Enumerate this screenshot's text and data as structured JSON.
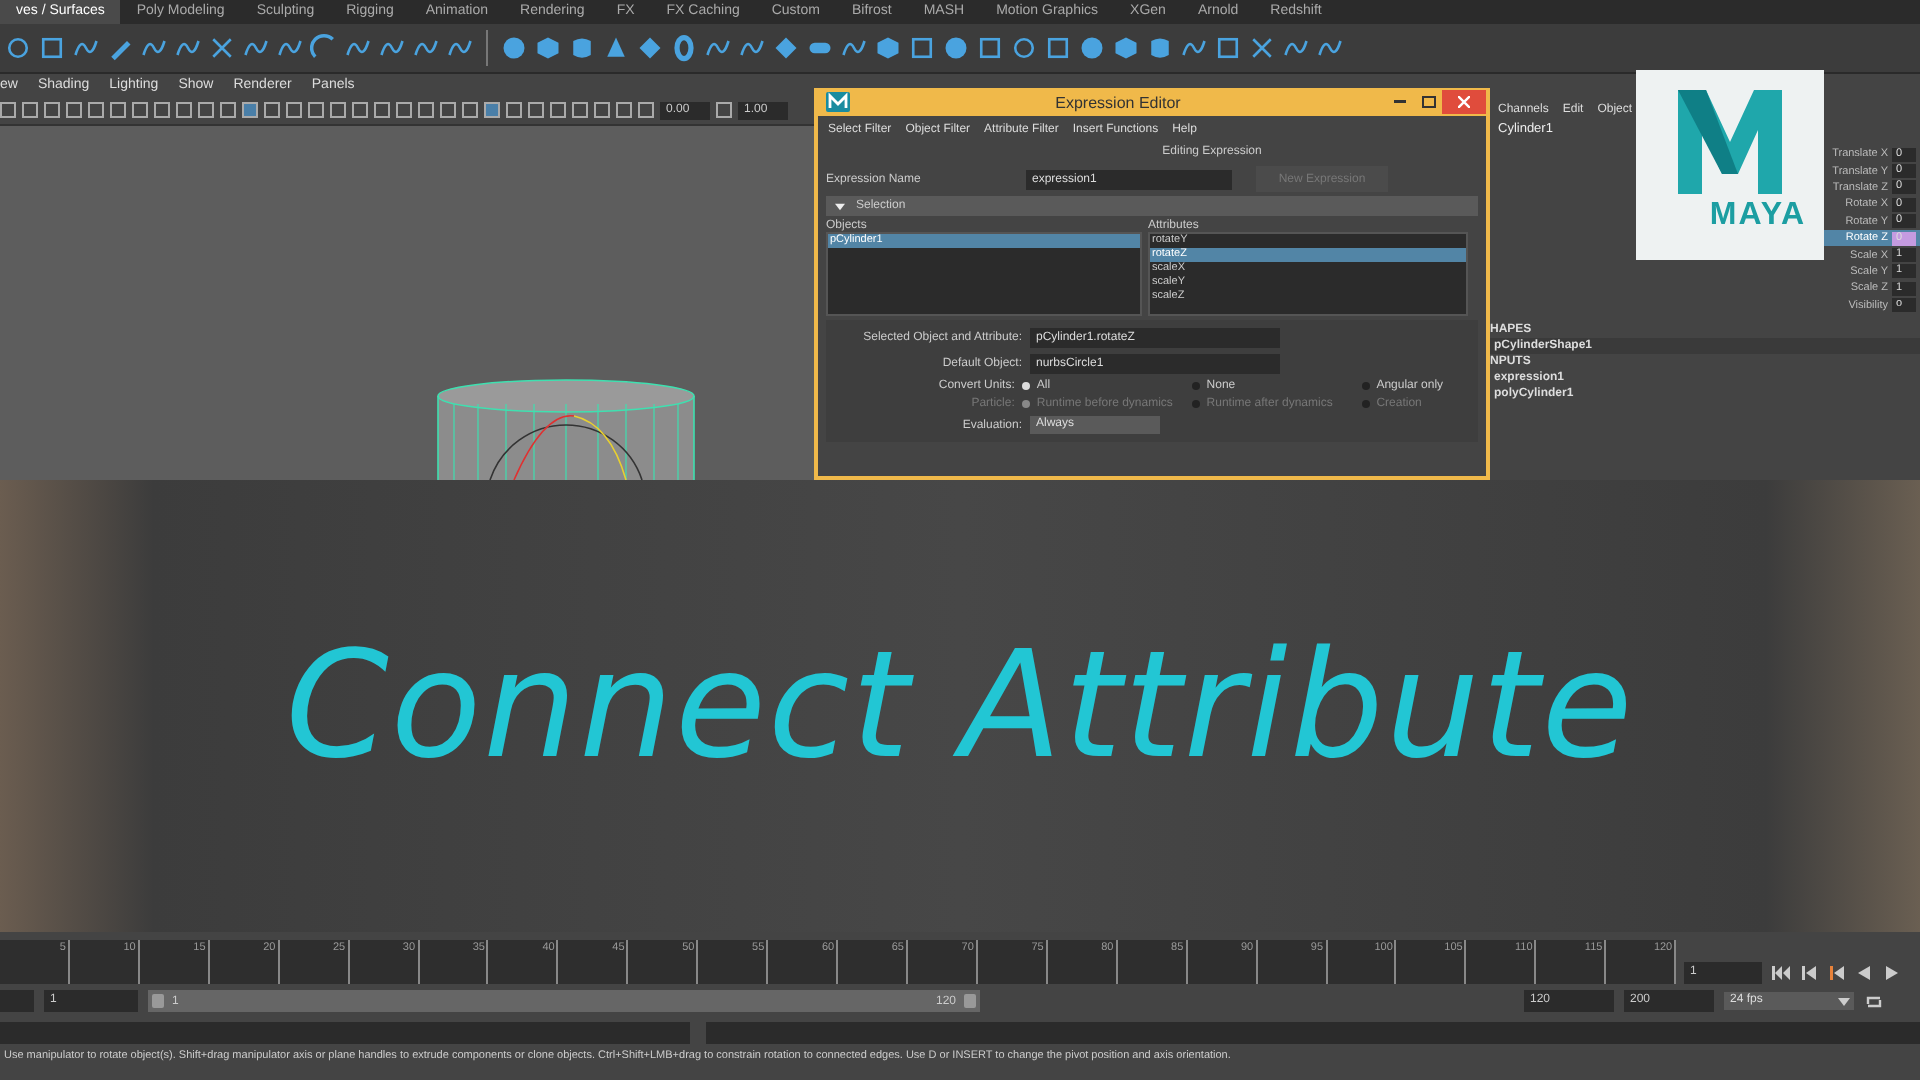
{
  "shelf_tabs": [
    {
      "label": "ves / Surfaces",
      "selected": true
    },
    {
      "label": "Poly Modeling",
      "selected": false
    },
    {
      "label": "Sculpting",
      "selected": false
    },
    {
      "label": "Rigging",
      "selected": false
    },
    {
      "label": "Animation",
      "selected": false
    },
    {
      "label": "Rendering",
      "selected": false
    },
    {
      "label": "FX",
      "selected": false
    },
    {
      "label": "FX Caching",
      "selected": false
    },
    {
      "label": "Custom",
      "selected": false
    },
    {
      "label": "Bifrost",
      "selected": false
    },
    {
      "label": "MASH",
      "selected": false
    },
    {
      "label": "Motion Graphics",
      "selected": false
    },
    {
      "label": "XGen",
      "selected": false
    },
    {
      "label": "Arnold",
      "selected": false
    },
    {
      "label": "Redshift",
      "selected": false
    }
  ],
  "panel_menu": [
    "ew",
    "Shading",
    "Lighting",
    "Show",
    "Renderer",
    "Panels"
  ],
  "panel_toolbar": {
    "fields": [
      "0.00",
      "1.00"
    ]
  },
  "expression_editor": {
    "title": "Expression Editor",
    "menu": [
      "Select Filter",
      "Object Filter",
      "Attribute Filter",
      "Insert Functions",
      "Help"
    ],
    "heading": "Editing Expression",
    "name_label": "Expression Name",
    "name_value": "expression1",
    "new_button": {
      "label": "New Expression",
      "disabled": true
    },
    "section": {
      "label": "Selection",
      "expanded": true
    },
    "objects": {
      "label": "Objects",
      "items": [
        {
          "label": "pCylinder1",
          "selected": true
        }
      ]
    },
    "attributes": {
      "label": "Attributes",
      "items": [
        {
          "label": "rotateY",
          "selected": false
        },
        {
          "label": "rotateZ",
          "selected": true
        },
        {
          "label": "scaleX",
          "selected": false
        },
        {
          "label": "scaleY",
          "selected": false
        },
        {
          "label": "scaleZ",
          "selected": false
        }
      ]
    },
    "fields": [
      {
        "label": "Selected Object and Attribute:",
        "value": "pCylinder1.rotateZ"
      },
      {
        "label": "Default Object:",
        "value": "nurbsCircle1"
      }
    ],
    "radio_groups": [
      {
        "label": "Convert Units:",
        "disabled": false,
        "options": [
          {
            "label": "All",
            "selected": true
          },
          {
            "label": "None",
            "selected": false
          },
          {
            "label": "Angular only",
            "selected": false
          }
        ]
      },
      {
        "label": "Particle:",
        "disabled": true,
        "options": [
          {
            "label": "Runtime before dynamics",
            "selected": true
          },
          {
            "label": "Runtime after dynamics",
            "selected": false
          },
          {
            "label": "Creation",
            "selected": false
          }
        ]
      }
    ],
    "evaluation": {
      "label": "Evaluation:",
      "value": "Always"
    }
  },
  "channel_box": {
    "menu": [
      "Channels",
      "Edit",
      "Object"
    ],
    "object": "Cylinder1",
    "channels": [
      {
        "name": "Translate X",
        "value": "0",
        "selected": false
      },
      {
        "name": "Translate Y",
        "value": "0",
        "selected": false
      },
      {
        "name": "Translate Z",
        "value": "0",
        "selected": false
      },
      {
        "name": "Rotate X",
        "value": "0",
        "selected": false
      },
      {
        "name": "Rotate Y",
        "value": "0",
        "selected": false
      },
      {
        "name": "Rotate Z",
        "value": "0",
        "selected": true
      },
      {
        "name": "Scale X",
        "value": "1",
        "selected": false
      },
      {
        "name": "Scale Y",
        "value": "1",
        "selected": false
      },
      {
        "name": "Scale Z",
        "value": "1",
        "selected": false
      },
      {
        "name": "Visibility",
        "value": "o",
        "selected": false
      }
    ],
    "shapes_heading": "HAPES",
    "shapes": [
      "pCylinderShape1"
    ],
    "inputs_heading": "NPUTS",
    "inputs": [
      "expression1",
      "polyCylinder1"
    ]
  },
  "logo": {
    "text": "MAYA"
  },
  "banner": {
    "title": "Connect Attribute"
  },
  "timeline": {
    "ticks": [
      "5",
      "10",
      "15",
      "20",
      "25",
      "30",
      "35",
      "40",
      "45",
      "50",
      "55",
      "60",
      "65",
      "70",
      "75",
      "80",
      "85",
      "90",
      "95",
      "100",
      "105",
      "110",
      "115",
      "120"
    ],
    "current_frame": "1"
  },
  "range": {
    "start": "1",
    "slider_start": "1",
    "slider_end": "120",
    "end": "120",
    "max": "200",
    "fps": "24 fps"
  },
  "help_line": "Use manipulator to rotate object(s). Shift+drag manipulator axis or plane handles to extrude components or clone objects. Ctrl+Shift+LMB+drag to constrain rotation to connected edges. Use D or INSERT to change the pivot position and axis orientation."
}
